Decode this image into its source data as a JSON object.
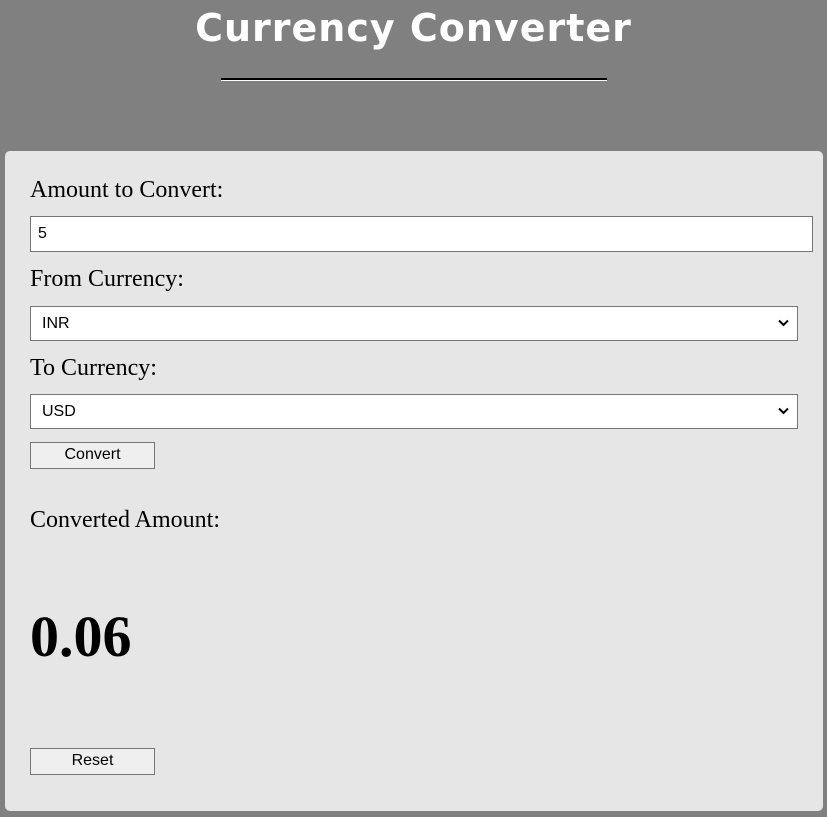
{
  "header": {
    "title": "Currency Converter"
  },
  "form": {
    "amount_label": "Amount to Convert:",
    "amount_value": "5",
    "from_label": "From Currency:",
    "from_value": "INR",
    "to_label": "To Currency:",
    "to_value": "USD",
    "convert_label": "Convert"
  },
  "result": {
    "label": "Converted Amount:",
    "value": "0.06"
  },
  "actions": {
    "reset_label": "Reset"
  },
  "colors": {
    "page_background": "#808080",
    "card_background": "#e6e6e6",
    "title_color": "#ffffff"
  },
  "icons": {
    "select_arrow": "chevron-down-icon"
  }
}
